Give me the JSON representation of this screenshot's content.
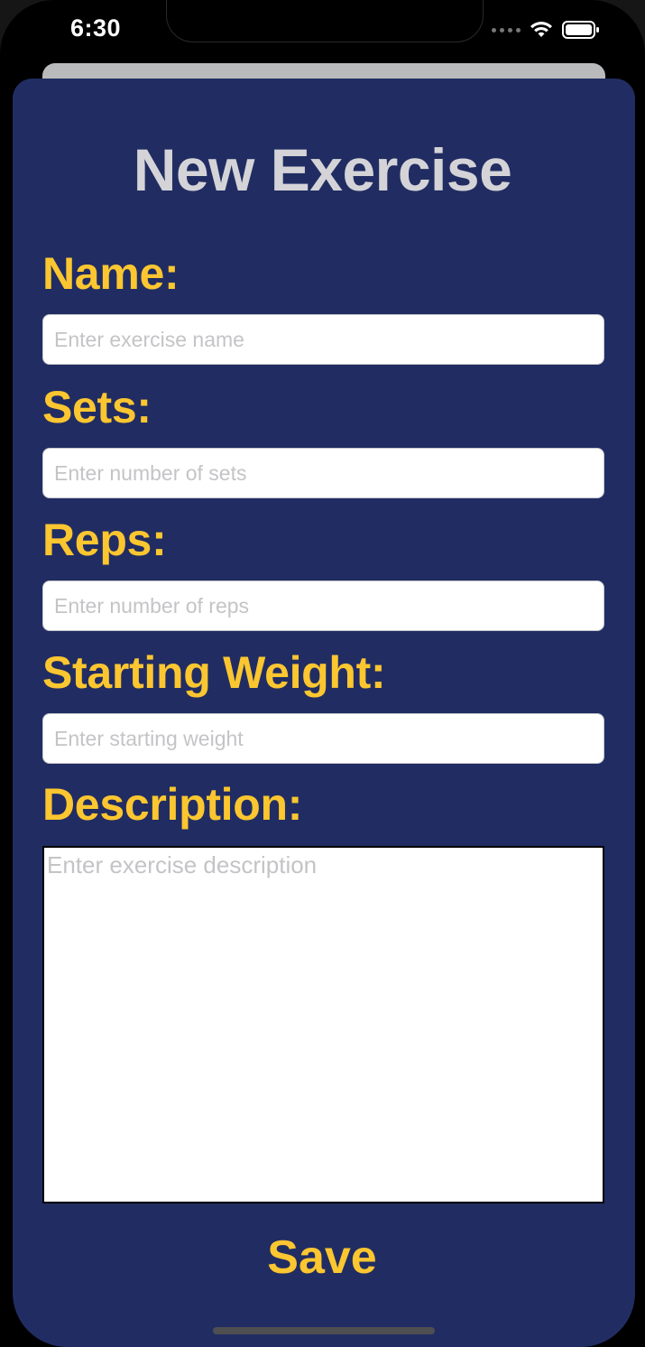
{
  "status_bar": {
    "time": "6:30"
  },
  "sheet": {
    "title": "New Exercise"
  },
  "form": {
    "name": {
      "label": "Name:",
      "placeholder": "Enter exercise name"
    },
    "sets": {
      "label": "Sets:",
      "placeholder": "Enter number of sets"
    },
    "reps": {
      "label": "Reps:",
      "placeholder": "Enter number of reps"
    },
    "starting_weight": {
      "label": "Starting Weight:",
      "placeholder": "Enter starting weight"
    },
    "description": {
      "label": "Description:",
      "placeholder": "Enter exercise description"
    }
  },
  "actions": {
    "save_label": "Save"
  },
  "colors": {
    "sheet_background": "#212d62",
    "label_accent": "#fcc630",
    "title_text": "#d4d4d8"
  }
}
